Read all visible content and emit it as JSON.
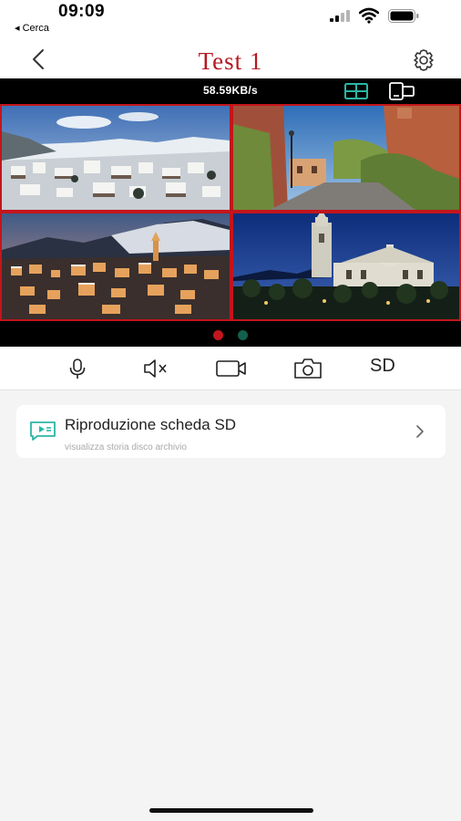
{
  "status_bar": {
    "time": "09:09",
    "back_app": "◂ Cerca"
  },
  "nav": {
    "title": "Test 1",
    "back_icon": "chevron-left-icon",
    "settings_icon": "gear-icon"
  },
  "video": {
    "speed": "58.59KB/s",
    "grid_view_icon": "quad-grid-icon",
    "layout_icon": "device-layout-icon",
    "cameras": [
      {
        "scene": "snowy mountain village"
      },
      {
        "scene": "castle street at sunset"
      },
      {
        "scene": "hill town at dusk"
      },
      {
        "scene": "basilica at night"
      }
    ],
    "pages": 2,
    "active_page": 1,
    "colors": {
      "border": "#c3151c",
      "dot_active": "#c3151c",
      "dot_inactive": "#135f4d"
    }
  },
  "toolbar": {
    "mic_icon": "microphone-icon",
    "mute_icon": "speaker-muted-icon",
    "record_icon": "video-record-icon",
    "snapshot_icon": "camera-icon",
    "sd_label": "SD"
  },
  "playback_card": {
    "title": "Riproduzione scheda SD",
    "subtitle": "visualizza storia disco archivio",
    "icon": "video-message-icon",
    "accent": "#2bb5a5"
  }
}
